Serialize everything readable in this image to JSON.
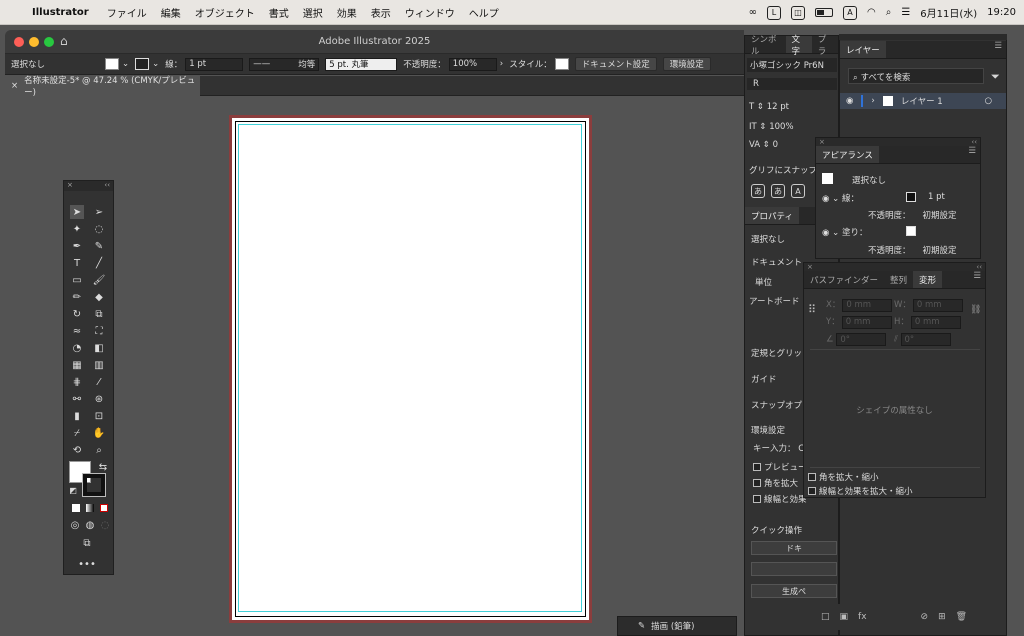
{
  "menubar": {
    "app": "Illustrator",
    "items": [
      "ファイル",
      "編集",
      "オブジェクト",
      "書式",
      "選択",
      "効果",
      "表示",
      "ウィンドウ",
      "ヘルプ"
    ],
    "date": "6月11日(水)",
    "time": "19:20",
    "input_mode": "A"
  },
  "window": {
    "title": "Adobe Illustrator 2025"
  },
  "controlbar": {
    "selection": "選択なし",
    "stroke_label": "線：",
    "stroke_value": "1 pt",
    "profile": "均等",
    "brush": "5 pt. 丸筆",
    "opacity_label": "不透明度：",
    "opacity_value": "100%",
    "style_label": "スタイル：",
    "doc_settings": "ドキュメント設定",
    "prefs": "環境設定"
  },
  "doc_tab": {
    "label": "名称未設定-5* @ 47.24 % (CMYK/プレビュー)"
  },
  "char_panel": {
    "tabs": [
      "シンボル",
      "文字",
      "プラ"
    ],
    "font": "小塚ゴシック Pr6N",
    "style": "R",
    "size": "12 pt",
    "scale": "100%",
    "tracking": "0",
    "glyph_snap": "グリフにスナップ"
  },
  "props_panel": {
    "tab": "プロパティ",
    "no_sel": "選択なし",
    "document": "ドキュメント",
    "unit": "単位",
    "artboard": "アートボード",
    "rulers": "定規とグリッ",
    "guides": "ガイド",
    "snap": "スナップオプ",
    "prefs": "環境設定",
    "key_input": "キー入力：",
    "key_val": "C",
    "preview": "プレビュー",
    "scale_corners": "角を拡大",
    "scale_strokes": "線幅と効果",
    "quick_actions": "クイック操作",
    "qa1": "ドキ",
    "qa3": "生成ぺ"
  },
  "layers_panel": {
    "tab": "レイヤー",
    "search_placeholder": "すべてを検索",
    "layer_name": "レイヤー 1"
  },
  "appearance_panel": {
    "tab": "アピアランス",
    "no_sel": "選択なし",
    "stroke": "線：",
    "stroke_val": "1 pt",
    "opacity": "不透明度：",
    "opacity_val": "初期設定",
    "fill": "塗り：",
    "opacity2": "不透明度：",
    "opacity2_val": "初期設定"
  },
  "transform_panel": {
    "tabs": [
      "パスファインダー",
      "整列",
      "変形"
    ],
    "x_label": "X：",
    "x_val": "0 mm",
    "y_label": "Y：",
    "y_val": "0 mm",
    "w_label": "W：",
    "w_val": "0 mm",
    "h_label": "H：",
    "h_val": "0 mm",
    "angle_val": "0°",
    "shear_val": "0°",
    "no_shape": "シェイプの属性なし",
    "scale_corners": "角を拡大・縮小",
    "scale_strokes": "線幅と効果を拡大・縮小"
  },
  "statusbar": {
    "draw_mode": "描画 (鉛筆)"
  },
  "colors": {
    "accent": "#2f72d9",
    "artboard_border": "#8b3d3d",
    "bleed": "#40d0d8"
  }
}
